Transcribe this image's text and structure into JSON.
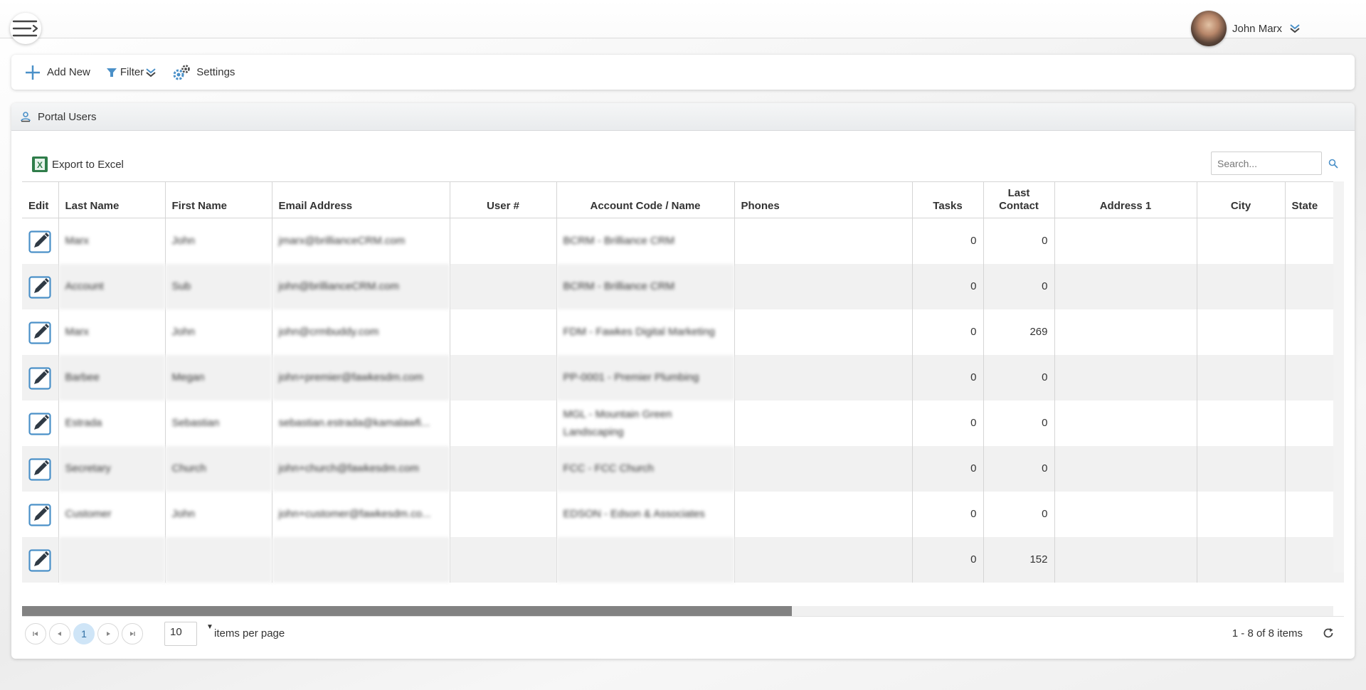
{
  "header": {
    "user_name": "John Marx",
    "menu_icon": "hamburger-menu-icon",
    "avatar_icon": "user-avatar"
  },
  "toolbar": {
    "add_new_label": "Add New",
    "filter_label": "Filter",
    "settings_label": "Settings"
  },
  "panel": {
    "title": "Portal Users",
    "export_label": "Export to Excel",
    "search_placeholder": "Search..."
  },
  "colors": {
    "accent": "#4a90c8",
    "edit_icon_border": "#4a90c8",
    "excel_green": "#2f7d4a",
    "active_page": "#cfe5f7"
  },
  "table": {
    "columns": {
      "edit": "Edit",
      "last_name": "Last Name",
      "first_name": "First Name",
      "email": "Email Address",
      "user_num": "User #",
      "account": "Account Code / Name",
      "phones": "Phones",
      "tasks": "Tasks",
      "last_contact_1": "Last",
      "last_contact_2": "Contact",
      "address1": "Address 1",
      "city": "City",
      "state": "State"
    },
    "rows": [
      {
        "last_name": "Marx",
        "first_name": "John",
        "email": "jmarx@brillianceCRM.com",
        "user_num": "",
        "account": "BCRM - Brilliance CRM",
        "phones": "",
        "tasks": "0",
        "last_contact": "0",
        "address1": "",
        "city": "",
        "state": ""
      },
      {
        "last_name": "Account",
        "first_name": "Sub",
        "email": "john@brillianceCRM.com",
        "user_num": "",
        "account": "BCRM - Brilliance CRM",
        "phones": "",
        "tasks": "0",
        "last_contact": "0",
        "address1": "",
        "city": "",
        "state": ""
      },
      {
        "last_name": "Marx",
        "first_name": "John",
        "email": "john@crmbuddy.com",
        "user_num": "",
        "account": "FDM - Fawkes Digital Marketing",
        "phones": "",
        "tasks": "0",
        "last_contact": "269",
        "address1": "",
        "city": "",
        "state": ""
      },
      {
        "last_name": "Barbee",
        "first_name": "Megan",
        "email": "john+premier@fawkesdm.com",
        "user_num": "",
        "account": "PP-0001 - Premier Plumbing",
        "phones": "",
        "tasks": "0",
        "last_contact": "0",
        "address1": "",
        "city": "",
        "state": ""
      },
      {
        "last_name": "Estrada",
        "first_name": "Sebastian",
        "email": "sebastian.estrada@kamalawfi...",
        "user_num": "",
        "account": "MGL - Mountain Green Landscaping",
        "phones": "",
        "tasks": "0",
        "last_contact": "0",
        "address1": "",
        "city": "",
        "state": ""
      },
      {
        "last_name": "Secretary",
        "first_name": "Church",
        "email": "john+church@fawkesdm.com",
        "user_num": "",
        "account": "FCC - FCC Church",
        "phones": "",
        "tasks": "0",
        "last_contact": "0",
        "address1": "",
        "city": "",
        "state": ""
      },
      {
        "last_name": "Customer",
        "first_name": "John",
        "email": "john+customer@fawkesdm.co...",
        "user_num": "",
        "account": "EDSON - Edson & Associates",
        "phones": "",
        "tasks": "0",
        "last_contact": "0",
        "address1": "",
        "city": "",
        "state": ""
      },
      {
        "last_name": "",
        "first_name": "",
        "email": "",
        "user_num": "",
        "account": "",
        "phones": "",
        "tasks": "0",
        "last_contact": "152",
        "address1": "",
        "city": "",
        "state": ""
      }
    ]
  },
  "pager": {
    "current_page": "1",
    "per_page": "10",
    "per_page_label": "items per page",
    "info": "1 - 8 of 8 items",
    "scroll_position": 0,
    "scroll_visible_fraction": 0.587
  }
}
